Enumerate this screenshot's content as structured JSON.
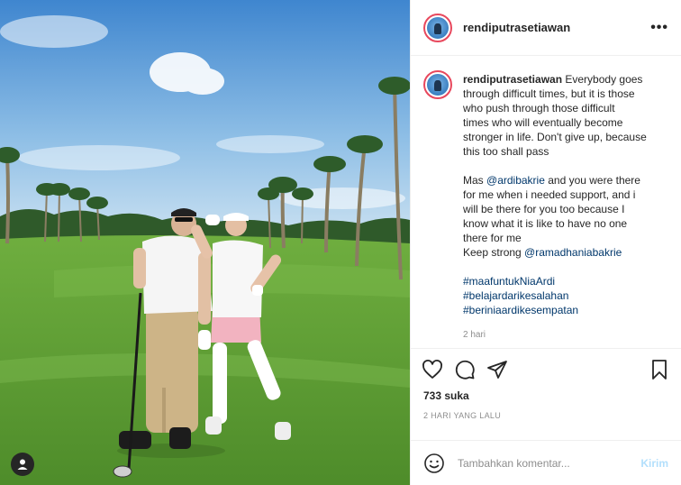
{
  "post": {
    "username": "rendiputrasetiawan",
    "more_icon": "more-horizontal-icon",
    "caption": {
      "lines": [
        "Everybody goes",
        "through difficult times, but it is those",
        "who push through those difficult",
        "times who will eventually become",
        "stronger in life. Don't give up, because",
        "this too shall pass"
      ],
      "para2": {
        "pre": "Mas ",
        "mention1": "@ardibakrie",
        "post1": " and you were there",
        "lines": [
          "for me when i needed support, and i",
          "will be there for you too because I",
          "know what it is like to have no one",
          "there for me"
        ],
        "keep": "Keep strong ",
        "mention2": "@ramadhaniabakrie"
      },
      "hashtags": [
        "#maafuntukNiaArdi",
        "#belajardarikesalahan",
        "#beriniaardikesempatan"
      ],
      "time": "2 hari"
    },
    "actions": [
      "heart-icon",
      "comment-icon",
      "share-icon",
      "bookmark-icon"
    ],
    "likes": "733 suka",
    "date": "2 HARI YANG LALU",
    "comment": {
      "placeholder": "Tambahkan komentar...",
      "send_label": "Kirim"
    },
    "colors": {
      "story_ring": "#e8485d",
      "link": "#00376b",
      "send_disabled": "#b2dffc",
      "muted": "#8e8e8e"
    }
  }
}
